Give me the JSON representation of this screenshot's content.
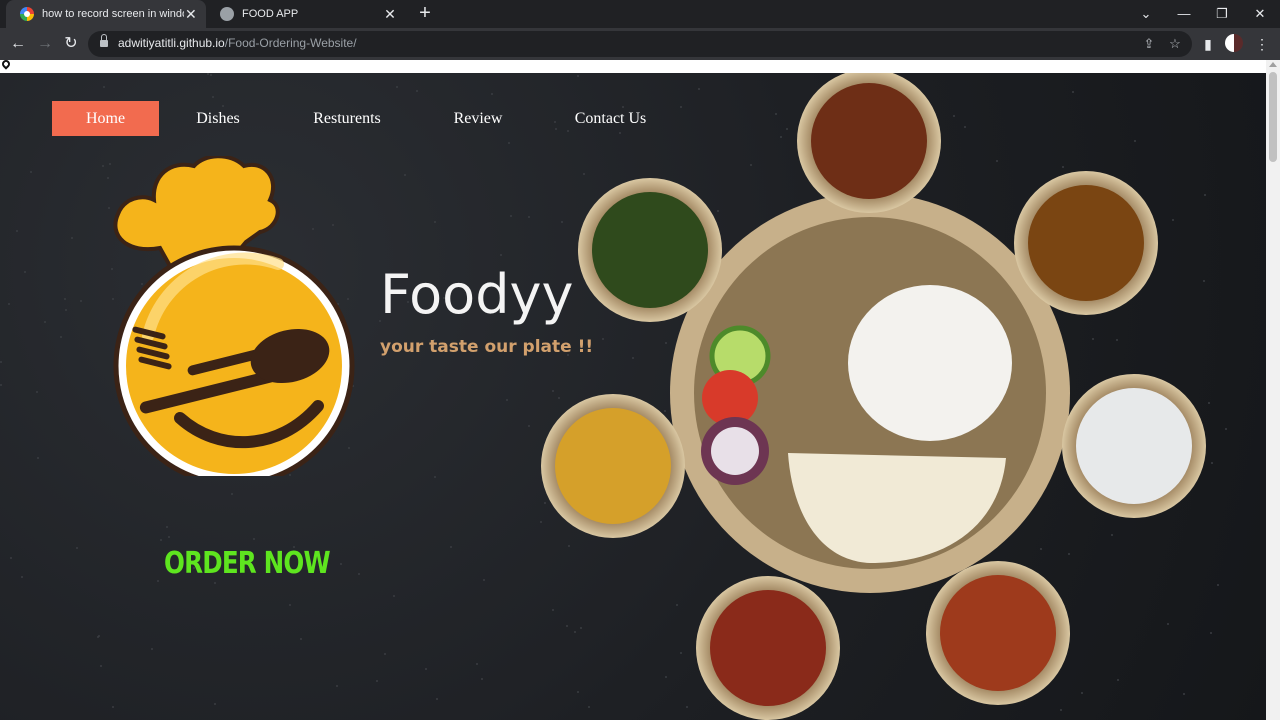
{
  "browser": {
    "tabs": [
      {
        "title": "how to record screen in windows",
        "active": true,
        "close": "✕"
      },
      {
        "title": "FOOD APP",
        "active": false,
        "close": "✕"
      }
    ],
    "new_tab": "+",
    "window_controls": {
      "dropdown": "⌄",
      "minimize": "—",
      "restore": "❐",
      "close": "✕"
    },
    "nav": {
      "back": "←",
      "forward": "→",
      "reload": "↻"
    },
    "address": {
      "host": "adwitiyatitli.github.io",
      "path": "/Food-Ordering-Website/"
    },
    "toolbar_icons": {
      "share": "⇪",
      "bookmark": "☆",
      "sidepanel": "▮",
      "menu": "⋮"
    }
  },
  "site": {
    "nav": [
      {
        "label": "Home",
        "active": true
      },
      {
        "label": "Dishes",
        "active": false
      },
      {
        "label": "Resturents",
        "active": false
      },
      {
        "label": "Review",
        "active": false
      },
      {
        "label": "Contact Us",
        "active": false
      }
    ],
    "brand": "Foodyy",
    "tagline": "your taste our plate !!",
    "cta": "ORDER NOW",
    "colors": {
      "accent": "#f26b4f",
      "cta": "#5ee51f",
      "tagline": "#d2a06d",
      "logo_yellow": "#f5b41b"
    }
  }
}
